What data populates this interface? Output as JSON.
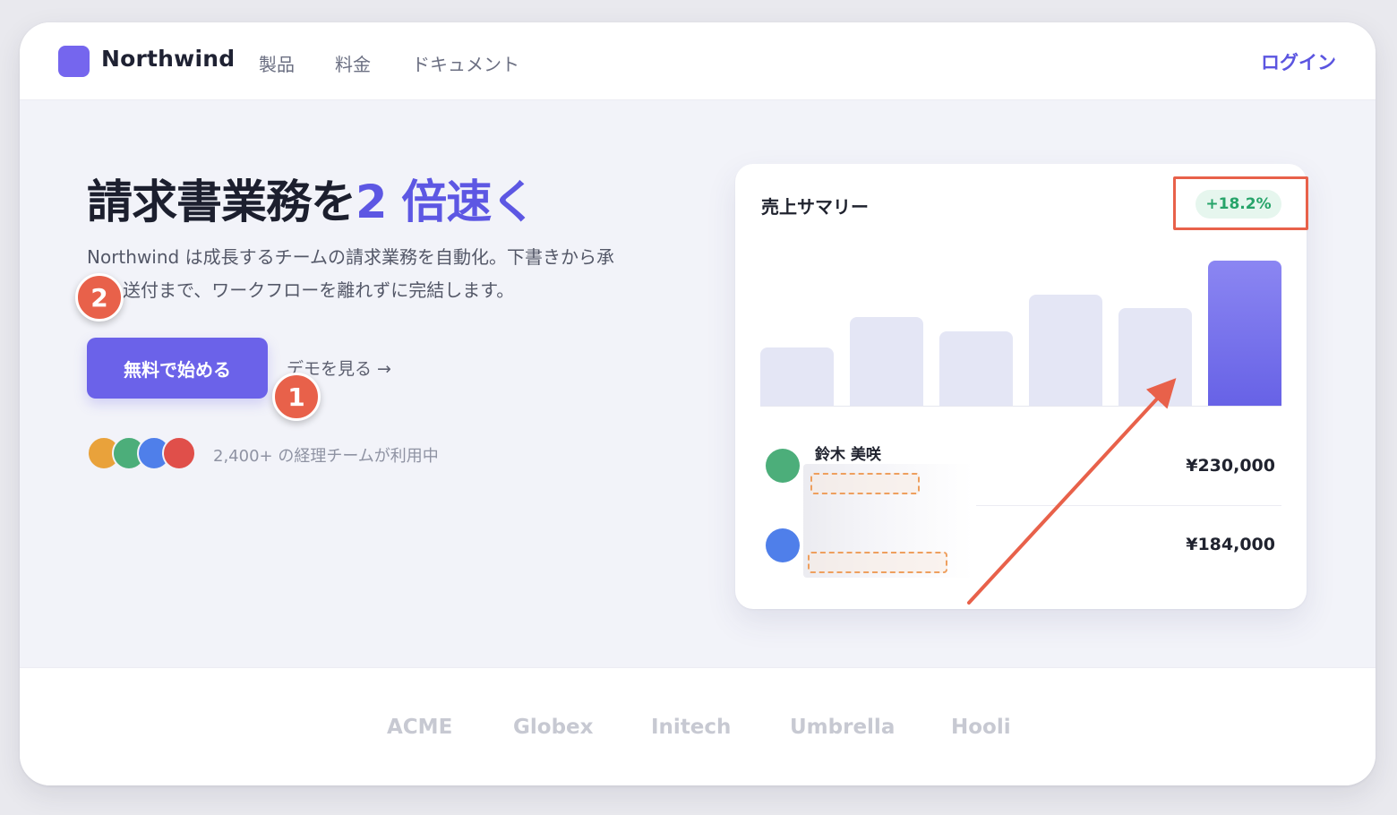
{
  "nav": {
    "brand": "Northwind",
    "links": [
      "製品",
      "料金",
      "ドキュメント"
    ],
    "login": "ログイン"
  },
  "hero": {
    "headline_main": "請求書業務を",
    "headline_accent": "2 倍速く",
    "subcopy": "Northwind は成長するチームの請求業務を自動化。下書きから承認・送付まで、ワークフローを離れずに完結します。",
    "cta_primary": "無料で始める",
    "cta_secondary": "デモを見る →",
    "social_proof": "2,400+ の経理チームが利用中",
    "avatar_colors": [
      "#e9a23b",
      "#4cae7a",
      "#4f7fea",
      "#e04f4a"
    ]
  },
  "summary_card": {
    "title": "売上サマリー",
    "change": "+18.2%",
    "chart_data": {
      "type": "bar",
      "values": [
        38,
        58,
        49,
        73,
        64,
        95
      ],
      "highlight_index": 5,
      "colors": {
        "normal": "#e4e6f5",
        "highlight": "#6b65e8"
      }
    },
    "rows": [
      {
        "name": "鈴木 美咲",
        "amount": "¥230,000",
        "dot_color": "#4cae7a"
      },
      {
        "name": "",
        "amount": "¥184,000",
        "dot_color": "#4f7fea"
      }
    ]
  },
  "partners": [
    "ACME",
    "Globex",
    "Initech",
    "Umbrella",
    "Hooli"
  ],
  "annotations": {
    "badge_1": "1",
    "badge_2": "2",
    "color": "#e8614a"
  }
}
